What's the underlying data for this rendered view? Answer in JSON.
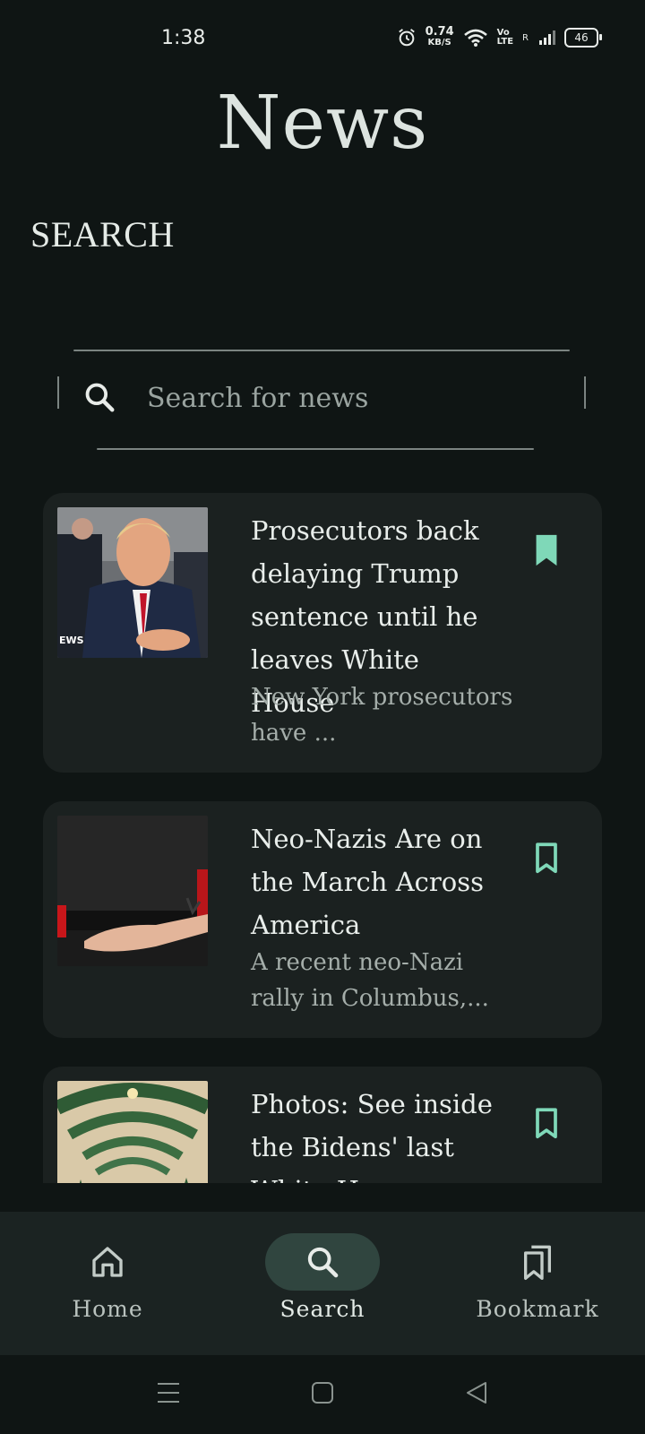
{
  "status_bar": {
    "time": "1:38",
    "net_speed_value": "0.74",
    "net_speed_unit": "KB/S",
    "volte_top": "Vo",
    "volte_bottom": "LTE",
    "roaming": "R",
    "battery": "46"
  },
  "app": {
    "title": "News",
    "section_heading": "SEARCH"
  },
  "search": {
    "placeholder": "Search for news",
    "value": ""
  },
  "articles": [
    {
      "title": "Prosecutors back delaying Trump sentence until he leaves White House",
      "description": "New York prosecutors have ...",
      "bookmarked": true,
      "thumb_caption": "EWS"
    },
    {
      "title": "Neo-Nazis Are on the March Across America",
      "description": "A recent neo-Nazi rally in Columbus,...",
      "bookmarked": false
    },
    {
      "title": "Photos: See inside the Bidens' last White House",
      "description": "",
      "bookmarked": false
    }
  ],
  "bottom_nav": {
    "items": [
      {
        "label": "Home",
        "icon": "home-icon",
        "active": false
      },
      {
        "label": "Search",
        "icon": "search-icon",
        "active": true
      },
      {
        "label": "Bookmark",
        "icon": "bookmarks-icon",
        "active": false
      }
    ]
  },
  "colors": {
    "background": "#0f1514",
    "card": "#1b2120",
    "accent": "#7fd8b8",
    "nav_active_pill": "#30453f"
  }
}
